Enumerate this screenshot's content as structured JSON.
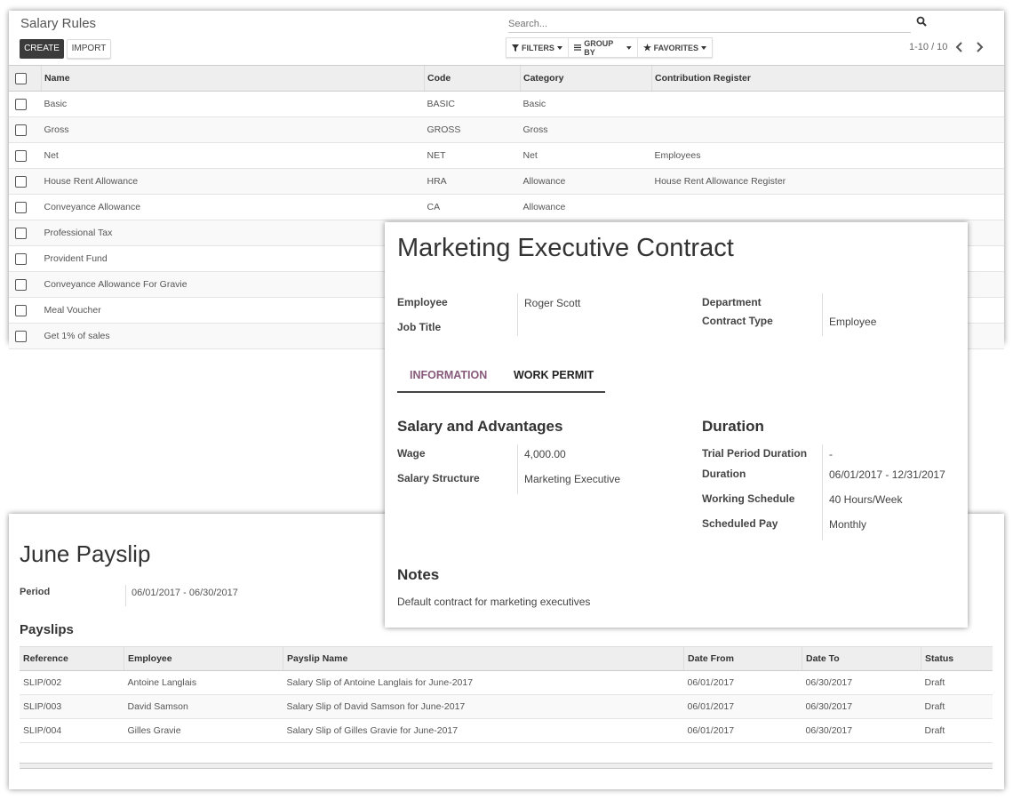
{
  "salary_rules": {
    "title": "Salary Rules",
    "create_label": "CREATE",
    "import_label": "IMPORT",
    "search_placeholder": "Search...",
    "filters_label": "FILTERS",
    "groupby_label": "GROUP BY",
    "favorites_label": "FAVORITES",
    "pager": "1-10 / 10",
    "columns": [
      "Name",
      "Code",
      "Category",
      "Contribution Register"
    ],
    "rows": [
      {
        "name": "Basic",
        "code": "BASIC",
        "category": "Basic",
        "register": ""
      },
      {
        "name": "Gross",
        "code": "GROSS",
        "category": "Gross",
        "register": ""
      },
      {
        "name": "Net",
        "code": "NET",
        "category": "Net",
        "register": "Employees"
      },
      {
        "name": "House Rent Allowance",
        "code": "HRA",
        "category": "Allowance",
        "register": "House Rent Allowance Register"
      },
      {
        "name": "Conveyance Allowance",
        "code": "CA",
        "category": "Allowance",
        "register": ""
      },
      {
        "name": "Professional Tax",
        "code": "",
        "category": "",
        "register": ""
      },
      {
        "name": "Provident Fund",
        "code": "",
        "category": "",
        "register": ""
      },
      {
        "name": "Conveyance Allowance For Gravie",
        "code": "",
        "category": "",
        "register": ""
      },
      {
        "name": "Meal Voucher",
        "code": "",
        "category": "",
        "register": ""
      },
      {
        "name": "Get 1% of sales",
        "code": "",
        "category": "",
        "register": ""
      }
    ]
  },
  "contract": {
    "title": "Marketing Executive Contract",
    "employee_label": "Employee",
    "employee_value": "Roger Scott",
    "job_title_label": "Job Title",
    "department_label": "Department",
    "contract_type_label": "Contract Type",
    "contract_type_value": "Employee",
    "tab_information": "INFORMATION",
    "tab_work_permit": "WORK PERMIT",
    "salary_heading": "Salary and Advantages",
    "wage_label": "Wage",
    "wage_value": "4,000.00",
    "structure_label": "Salary Structure",
    "structure_value": "Marketing Executive",
    "duration_heading": "Duration",
    "trial_label": "Trial Period Duration",
    "trial_value": "-",
    "duration_label": "Duration",
    "duration_value": "06/01/2017 - 12/31/2017",
    "schedule_label": "Working Schedule",
    "schedule_value": "40 Hours/Week",
    "scheduled_pay_label": "Scheduled Pay",
    "scheduled_pay_value": "Monthly",
    "notes_heading": "Notes",
    "notes_text": "Default contract for marketing executives"
  },
  "payslip": {
    "title": "June Payslip",
    "period_label": "Period",
    "period_value": "06/01/2017 - 06/30/2017",
    "payslips_heading": "Payslips",
    "columns": [
      "Reference",
      "Employee",
      "Payslip Name",
      "Date From",
      "Date To",
      "Status"
    ],
    "rows": [
      {
        "ref": "SLIP/002",
        "employee": "Antoine Langlais",
        "name": "Salary Slip of Antoine Langlais for June-2017",
        "from": "06/01/2017",
        "to": "06/30/2017",
        "status": "Draft"
      },
      {
        "ref": "SLIP/003",
        "employee": "David Samson",
        "name": "Salary Slip of David Samson for June-2017",
        "from": "06/01/2017",
        "to": "06/30/2017",
        "status": "Draft"
      },
      {
        "ref": "SLIP/004",
        "employee": "Gilles Gravie",
        "name": "Salary Slip of Gilles Gravie for June-2017",
        "from": "06/01/2017",
        "to": "06/30/2017",
        "status": "Draft"
      }
    ]
  },
  "colors": {
    "accent": "#875a7b",
    "create_button": "#3b3b3b"
  }
}
